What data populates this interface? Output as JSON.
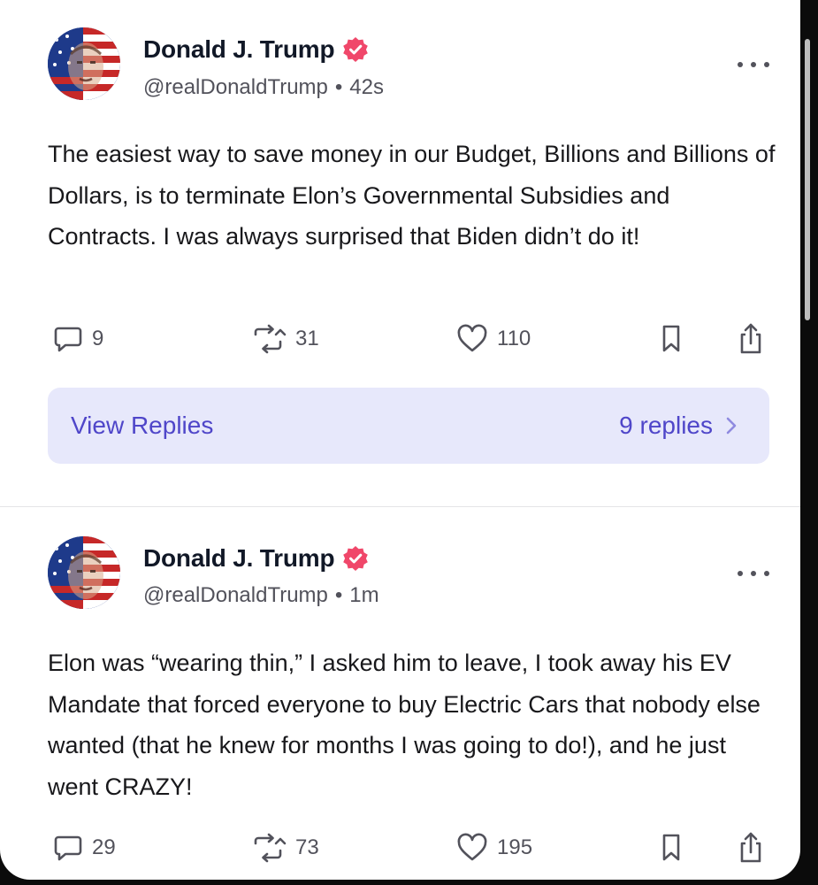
{
  "colors": {
    "background": "#ffffff",
    "verified_badge": "#f0476a",
    "replies_box": "#e7e8fb",
    "accent_text": "#4f46c9",
    "secondary_text": "#52525b"
  },
  "posts": [
    {
      "author": {
        "display_name": "Donald J. Trump",
        "handle": "@realDonaldTrump",
        "verified_icon": "verified-badge-icon",
        "avatar": "avatar-flag-portrait"
      },
      "timestamp": "42s",
      "body": "The easiest way to save money in our Budget, Billions and Billions of Dollars, is to terminate Elon’s Governmental Subsidies and Contracts. I was always surprised that Biden didn’t do it!",
      "stats": {
        "replies": "9",
        "reposts": "31",
        "likes": "110"
      },
      "view_replies": {
        "label": "View Replies",
        "count_text": "9 replies"
      }
    },
    {
      "author": {
        "display_name": "Donald J. Trump",
        "handle": "@realDonaldTrump",
        "verified_icon": "verified-badge-icon",
        "avatar": "avatar-flag-portrait"
      },
      "timestamp": "1m",
      "body": "Elon was “wearing thin,” I asked him to leave, I took away his EV Mandate that forced everyone to buy Electric Cars that nobody else wanted (that he knew for months I was going to do!), and he just went CRAZY!",
      "stats": {
        "replies": "29",
        "reposts": "73",
        "likes": "195"
      }
    }
  ],
  "icons": {
    "reply": "comment-icon",
    "repost": "repost-icon",
    "like": "heart-icon",
    "bookmark": "bookmark-icon",
    "share": "share-icon",
    "more": "more-options-icon",
    "chevron": "chevron-right-icon"
  }
}
